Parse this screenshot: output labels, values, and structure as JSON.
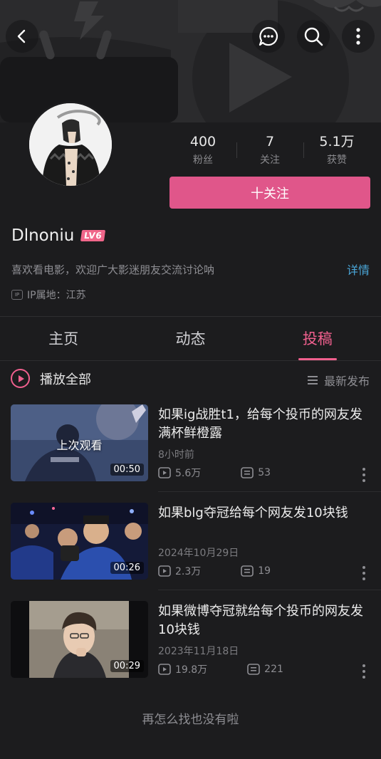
{
  "header": {
    "back_icon": "back-arrow-icon",
    "actions": [
      {
        "name": "message-icon"
      },
      {
        "name": "search-icon"
      },
      {
        "name": "more-vertical-icon"
      }
    ]
  },
  "profile": {
    "stats": [
      {
        "value": "400",
        "label": "粉丝"
      },
      {
        "value": "7",
        "label": "关注"
      },
      {
        "value": "5.1万",
        "label": "获赞"
      }
    ],
    "follow_label": "十关注",
    "username": "Dlnoniu",
    "level_badge": "LV6",
    "bio": "喜欢看电影，欢迎广大影迷朋友交流讨论呐",
    "detail_label": "详情",
    "ip_badge": "IP",
    "ip_location": "IP属地：江苏"
  },
  "tabs": [
    {
      "label": "主页",
      "active": false
    },
    {
      "label": "动态",
      "active": false
    },
    {
      "label": "投稿",
      "active": true
    }
  ],
  "list_header": {
    "play_all_label": "播放全部",
    "sort_label": "最新发布"
  },
  "videos": [
    {
      "title": "如果ig战胜t1，给每个投币的网友发满杯鲜橙露",
      "date": "8小时前",
      "views": "5.6万",
      "comments": "53",
      "duration": "00:50",
      "overlay": "上次观看"
    },
    {
      "title": "如果blg夺冠给每个网友发10块钱",
      "date": "2024年10月29日",
      "views": "2.3万",
      "comments": "19",
      "duration": "00:26"
    },
    {
      "title": "如果微博夺冠就给每个投币的网友发10块钱",
      "date": "2023年11月18日",
      "views": "19.8万",
      "comments": "221",
      "duration": "00:29"
    }
  ],
  "footer_text": "再怎么找也没有啦",
  "colors": {
    "accent": "#f0608e",
    "follow_button": "#e0568a",
    "link": "#4aa6d8",
    "background": "#1c1c1e"
  }
}
